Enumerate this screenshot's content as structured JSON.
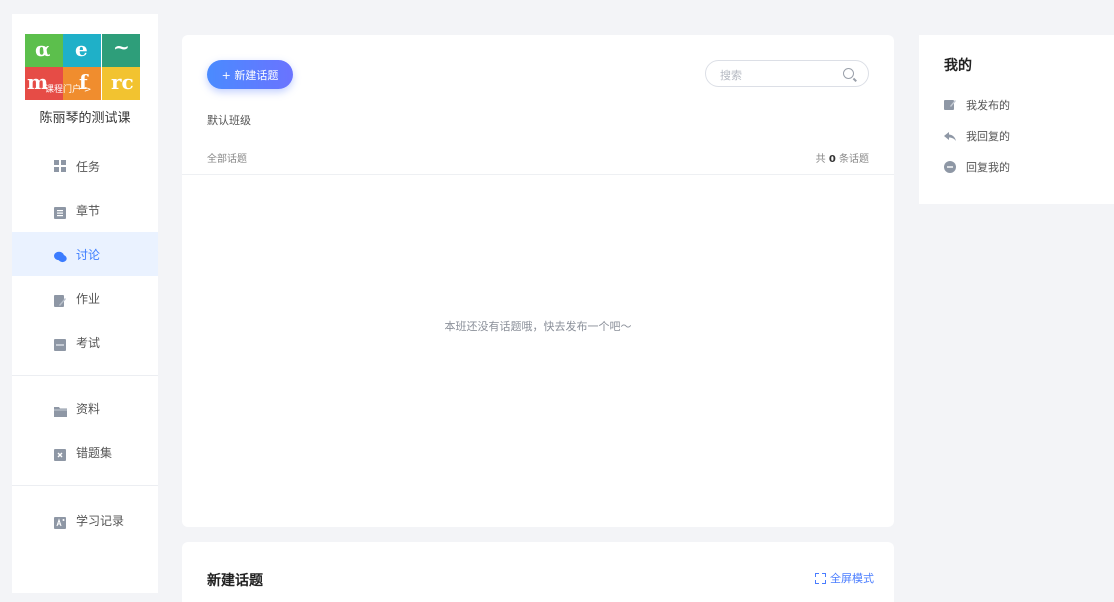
{
  "sidebar": {
    "course_name": "陈丽琴的测试课",
    "logo_caption": "课程门户 > ",
    "logo_letters": [
      "α",
      "e",
      "~",
      "m",
      "f",
      "rc"
    ],
    "nav": [
      {
        "id": "task",
        "label": "任务",
        "icon": "grid-icon",
        "active": false
      },
      {
        "id": "chapter",
        "label": "章节",
        "icon": "list-icon",
        "active": false
      },
      {
        "id": "discussion",
        "label": "讨论",
        "icon": "chat-bubbles-icon",
        "active": true
      },
      {
        "id": "homework",
        "label": "作业",
        "icon": "edit-icon",
        "active": false
      },
      {
        "id": "exam",
        "label": "考试",
        "icon": "exam-icon",
        "active": false
      },
      {
        "id": "material",
        "label": "资料",
        "icon": "folder-icon",
        "active": false
      },
      {
        "id": "wrong",
        "label": "错题集",
        "icon": "wrong-set-icon",
        "active": false
      },
      {
        "id": "record",
        "label": "学习记录",
        "icon": "record-icon",
        "active": false
      }
    ],
    "active_color": "#3b7cff"
  },
  "main": {
    "new_topic_button": "+ 新建话题",
    "search_placeholder": "搜索",
    "class_name": "默认班级",
    "all_topics": "全部话题",
    "count_prefix": "共 ",
    "count_value": "0",
    "count_suffix": " 条话题",
    "empty_text": "本班还没有话题哦，快去发布一个吧～"
  },
  "mine": {
    "title": "我的",
    "items": [
      {
        "label": "我发布的",
        "icon": "published-icon"
      },
      {
        "label": "我回复的",
        "icon": "reply-icon"
      },
      {
        "label": "回复我的",
        "icon": "comment-icon"
      }
    ]
  },
  "new_topic": {
    "title": "新建话题",
    "fullscreen": "全屏模式"
  },
  "colors": {
    "accent": "#4a8bff",
    "background": "#f3f4f7"
  }
}
